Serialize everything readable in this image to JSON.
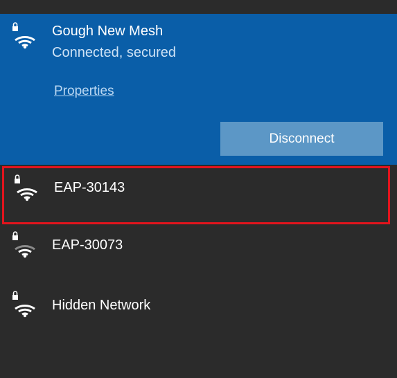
{
  "connected": {
    "ssid": "Gough New Mesh",
    "status": "Connected, secured",
    "properties_label": "Properties",
    "disconnect_label": "Disconnect",
    "icon": "secured-wifi-icon"
  },
  "networks": [
    {
      "ssid": "EAP-30143",
      "icon": "secured-wifi-icon",
      "selected": true
    },
    {
      "ssid": "EAP-30073",
      "icon": "secured-wifi-icon",
      "selected": false
    },
    {
      "ssid": "Hidden Network",
      "icon": "secured-wifi-icon",
      "selected": false
    }
  ],
  "colors": {
    "connected_bg": "#0a5ea8",
    "list_bg": "#2b2b2b",
    "button_bg": "#5c97c6",
    "highlight": "#e3141d"
  }
}
